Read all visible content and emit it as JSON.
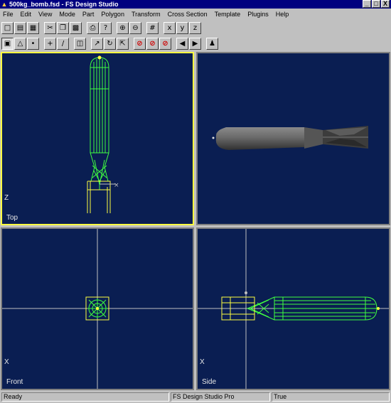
{
  "window": {
    "title": "500kg_bomb.fsd - FS Design Studio",
    "minimize": "_",
    "maximize": "□",
    "close": "X"
  },
  "menu": [
    "File",
    "Edit",
    "View",
    "Mode",
    "Part",
    "Polygon",
    "Transform",
    "Cross Section",
    "Template",
    "Plugins",
    "Help"
  ],
  "viewports": {
    "top": {
      "label": "Top",
      "axis": "Z"
    },
    "perspective": {
      "label": ""
    },
    "front": {
      "label": "Front",
      "axis": "X"
    },
    "side": {
      "label": "Side",
      "axis": "X"
    }
  },
  "status": {
    "left": "Ready",
    "middle": "FS Design Studio Pro",
    "right": "True"
  },
  "colors": {
    "viewport_bg": "#0a1e52",
    "wireframe": "#40ff40",
    "selection": "#ffff40",
    "axis": "#c0c0c0"
  }
}
